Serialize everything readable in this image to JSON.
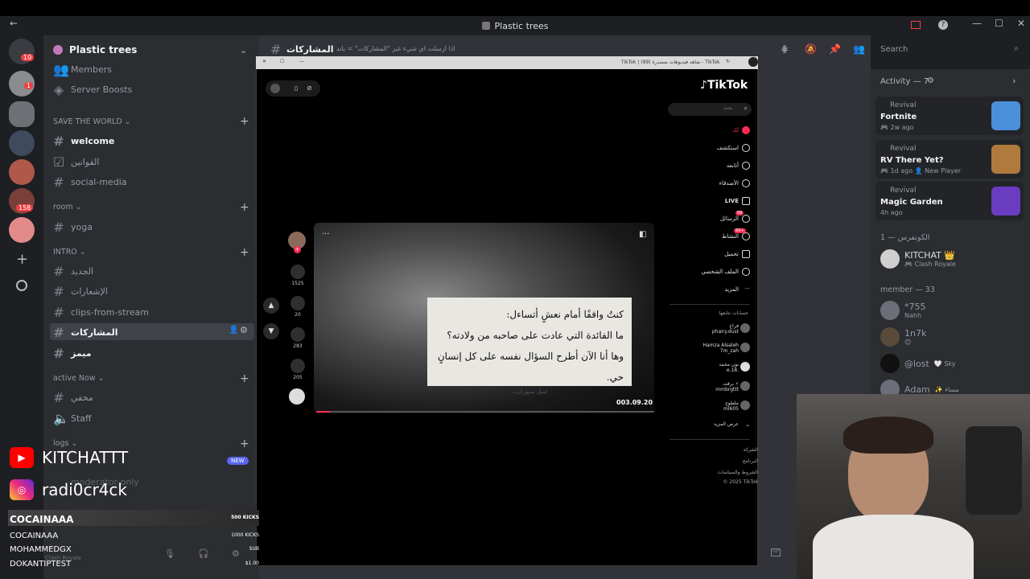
{
  "window": {
    "title": "Plastic trees",
    "back_arrow": "←",
    "help": "?",
    "minimize": "—",
    "maximize": "☐",
    "close": "✕"
  },
  "server": {
    "name": "Plastic trees",
    "top_items": [
      "Members",
      "Server Boosts"
    ],
    "categories": [
      {
        "label": "SAVE THE WORLD ⌄",
        "channels": [
          "welcome",
          "القوانين",
          "social-media"
        ]
      },
      {
        "label": "room ⌄",
        "channels": [
          "yoga"
        ]
      },
      {
        "label": "INTRO ⌄",
        "channels": [
          "الجديد",
          "الإشعارات",
          "clips-from-stream",
          "المشاركات",
          "ميمز"
        ]
      },
      {
        "label": "active Now ⌄",
        "channels": [
          "مخفي",
          "Staff"
        ]
      },
      {
        "label": "logs ⌄",
        "channels": [
          "moderator-only"
        ]
      }
    ],
    "new_badge": "NEW",
    "rail_badges": [
      "1",
      "158"
    ],
    "rail_count": "10"
  },
  "chat_header": {
    "channel": "المشاركات",
    "topic": "اذا ارسلت اي شيء غير \"المشاركات\" = باند",
    "search_placeholder": "Search"
  },
  "activity": {
    "header": "Activity — 7",
    "cards": [
      {
        "label": "Revival",
        "title": "Fortnite",
        "sub": "🎮 2w ago",
        "color": "#4a90d9"
      },
      {
        "label": "Revival",
        "title": "RV There Yet?",
        "sub": "🎮 1d ago  👤 New Player",
        "color": "#b07a3c"
      },
      {
        "label": "Revival",
        "title": "Magic Garden",
        "sub": "4h ago",
        "color": "#6a3cc0"
      }
    ]
  },
  "members": {
    "group1": "الكونفرس — 1",
    "owner": {
      "name": "KITCHAT 👑",
      "status": "🎮 Clash Royale"
    },
    "group2": "member — 33",
    "list": [
      {
        "name": "*755",
        "status": "Nahh"
      },
      {
        "name": "1n7k",
        "status": "😊"
      },
      {
        "name": "@lost",
        "status": "🤍 Sky"
      },
      {
        "name": "Adam",
        "status": "✨ مساء"
      }
    ]
  },
  "browser": {
    "url_text": "TikTok | شاهد فيديوهات متصدرة (99) - TikTok",
    "logo": "TikTok",
    "search_placeholder": "بحث",
    "nav": [
      "لك",
      "استكشف",
      "أتابعه",
      "الأصدقاء",
      "LIVE",
      "الرسائل",
      "النشاط",
      "تحميل",
      "الملف الشخصي",
      "المزيد"
    ],
    "badge_messages": "99",
    "badge_activity": "99+",
    "following_title": "حسابات تتابعها",
    "following": [
      {
        "name": "فراح",
        "handle": "phairy.dust"
      },
      {
        "name": "Hamza Alsaleh",
        "handle": "7m_zah"
      },
      {
        "name": "نون محمد",
        "handle": "e.18."
      },
      {
        "name": "برقت ⚡",
        "handle": "mmbrgttt"
      },
      {
        "name": "ملطوع",
        "handle": "ml605"
      }
    ],
    "show_more": "عرض المزيد",
    "footer": [
      "الشركة",
      "البرنامج",
      "الشروط والسياسات",
      "© 2025 TikTok"
    ],
    "video": {
      "quote_lines": [
        "كنتُ واقفًا أمام نعشٍ أتساءل:",
        "ما الفائدة التي عادت على صاحبه من ولادته؟",
        "وها أنا الآن أطرح السؤال نفسه على كل إنسانٍ حي."
      ],
      "quote_author": "إميل سيوران...",
      "date": "003.09.20",
      "progress": 0.04
    },
    "actions": {
      "likes": "1525",
      "comments": "20",
      "saves": "283",
      "shares": "205"
    }
  },
  "overlay": {
    "youtube": "KITCHATTT",
    "instagram": "radi0cr4ck",
    "alerts": [
      {
        "name": "COCAINAAA",
        "amount": "500 KICKS"
      },
      {
        "name": "COCAINAAA",
        "amount": "1000 KICKS"
      },
      {
        "name": "MOHAMMEDGX",
        "amount": "SUB"
      },
      {
        "name": "DOKANTIPTEST",
        "amount": "$1.00"
      }
    ],
    "user_status": "Clash Royale"
  }
}
